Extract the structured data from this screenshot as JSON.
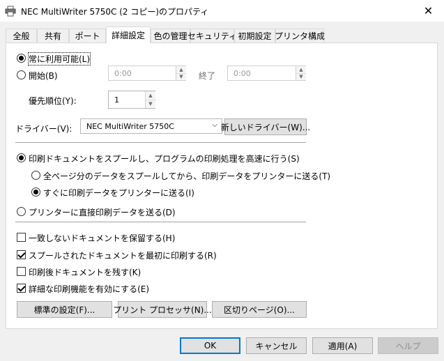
{
  "window": {
    "title": "NEC MultiWriter 5750C (2 コピー)のプロパティ",
    "close_glyph": "✕"
  },
  "tabs": [
    {
      "label": "全般"
    },
    {
      "label": "共有"
    },
    {
      "label": "ポート"
    },
    {
      "label": "詳細設定",
      "active": true
    },
    {
      "label": "色の管理"
    },
    {
      "label": "セキュリティ"
    },
    {
      "label": "初期設定"
    },
    {
      "label": "プリンタ構成"
    }
  ],
  "availability": {
    "always_label": "常に利用可能(L)",
    "from_label": "開始(B)",
    "from_value": "0:00",
    "to_label": "終了",
    "to_value": "0:00"
  },
  "priority": {
    "label": "優先順位(Y):",
    "value": "1"
  },
  "driver": {
    "label": "ドライバー(V):",
    "value": "NEC MultiWriter 5750C",
    "new_button": "新しいドライバー(W)..."
  },
  "spool": {
    "spool_label": "印刷ドキュメントをスプールし、プログラムの印刷処理を高速に行う(S)",
    "after_last_page": "全ページ分のデータをスプールしてから、印刷データをプリンターに送る(T)",
    "immediately": "すぐに印刷データをプリンターに送る(I)",
    "direct": "プリンターに直接印刷データを送る(D)"
  },
  "options": {
    "hold_mismatched": "一致しないドキュメントを保留する(H)",
    "spooled_first": "スプールされたドキュメントを最初に印刷する(R)",
    "keep_printed": "印刷後ドキュメントを残す(K)",
    "advanced_features": "詳細な印刷機能を有効にする(E)"
  },
  "lower_buttons": {
    "defaults": "標準の設定(F)...",
    "processor": "プリント プロセッサ(N)...",
    "separator": "区切りページ(O)..."
  },
  "dialog_buttons": {
    "ok": "OK",
    "cancel": "キャンセル",
    "apply": "適用(A)",
    "help": "ヘルプ"
  },
  "icons": {
    "printer": "printer-icon",
    "close": "close-icon",
    "chevron": "chevron-down-icon"
  }
}
